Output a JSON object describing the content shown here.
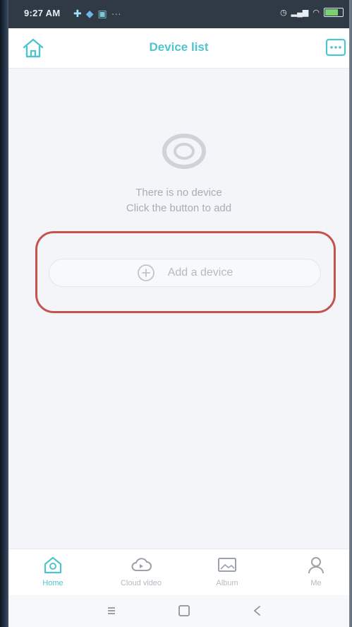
{
  "status_bar": {
    "time": "9:27 AM",
    "notification_icons": [
      "plus-icon",
      "shield-icon",
      "message-icon",
      "more-icon"
    ],
    "signal_icons": [
      "alarm-icon",
      "signal-icon",
      "wifi-icon",
      "battery-icon"
    ]
  },
  "header": {
    "title": "Device list",
    "left_icon": "home-icon",
    "right_icon": "menu-icon"
  },
  "empty_state": {
    "icon": "camera-lens-icon",
    "line1": "There is no device",
    "line2": "Click the button to add"
  },
  "add_button": {
    "label": "Add a device",
    "icon": "plus-circle-icon"
  },
  "tabs": [
    {
      "label": "Home",
      "icon": "home-tab-icon",
      "active": true
    },
    {
      "label": "Cloud video",
      "icon": "cloud-video-icon",
      "active": false
    },
    {
      "label": "Album",
      "icon": "album-icon",
      "active": false
    },
    {
      "label": "Me",
      "icon": "person-icon",
      "active": false
    }
  ],
  "colors": {
    "accent": "#4fc4cf",
    "highlight": "#c4534e",
    "muted_text": "#a7adb6",
    "background": "#f4f5f9"
  }
}
